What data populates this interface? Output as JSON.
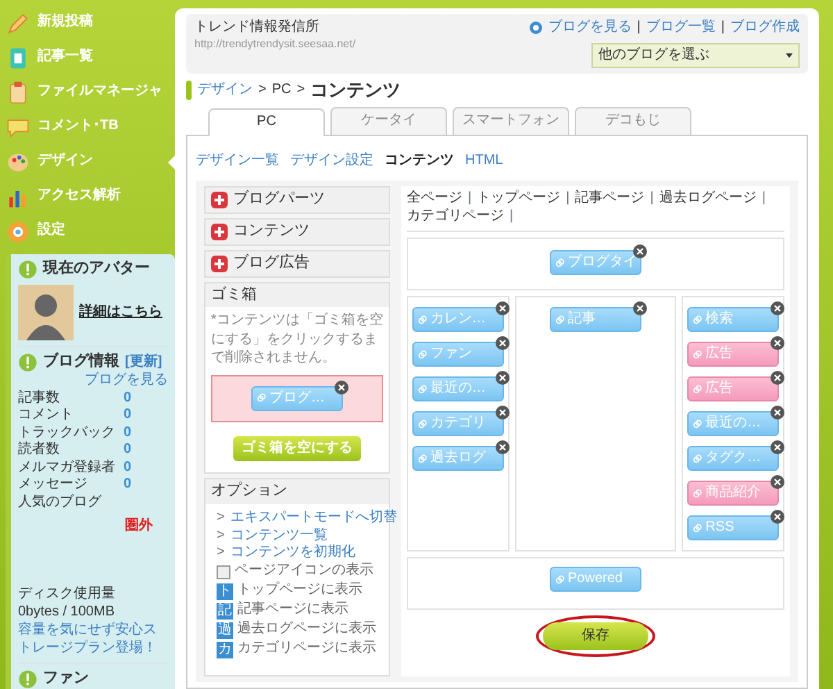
{
  "sidebar": {
    "menu": [
      {
        "label": "新規投稿",
        "selected": false
      },
      {
        "label": "記事一覧",
        "selected": false
      },
      {
        "label": "ファイルマネージャ",
        "selected": false
      },
      {
        "label": "コメント･TB",
        "selected": false
      },
      {
        "label": "デザイン",
        "selected": true
      },
      {
        "label": "アクセス解析",
        "selected": false
      },
      {
        "label": "設定",
        "selected": false
      }
    ],
    "avatar": {
      "title": "現在のアバター",
      "link": "詳細はこちら"
    },
    "blog_info": {
      "title": "ブログ情報",
      "refresh": "[更新]",
      "view_link": "ブログを見る",
      "stats": [
        {
          "label": "記事数",
          "value": "0",
          "alert": false
        },
        {
          "label": "コメント",
          "value": "0",
          "alert": false
        },
        {
          "label": "トラックバック",
          "value": "0",
          "alert": false
        },
        {
          "label": "読者数",
          "value": "0",
          "alert": false
        },
        {
          "label": "メルマガ登録者",
          "value": "0",
          "alert": false
        },
        {
          "label": "メッセージ",
          "value": "0",
          "alert": false
        },
        {
          "label": "人気のブログ",
          "value": "圏外",
          "alert": true
        }
      ]
    },
    "disk": {
      "label": "ディスク使用量",
      "usage": "0bytes / 100MB",
      "promo": "容量を気にせず安心ストレージプラン登場！"
    },
    "fan": {
      "title": "ファン"
    }
  },
  "header": {
    "site_title": "トレンド情報発信所",
    "url": "http://trendytrendysit.seesaa.net/",
    "separator": "|",
    "links": [
      "ブログを見る",
      "ブログ一覧",
      "ブログ作成"
    ],
    "blog_select": "他のブログを選ぶ"
  },
  "breadcrumb": {
    "separator": ">",
    "items": [
      "デザイン",
      "PC",
      "コンテンツ"
    ]
  },
  "tabs": [
    {
      "label": "PC",
      "selected": true
    },
    {
      "label": "ケータイ",
      "selected": false
    },
    {
      "label": "スマートフォン",
      "selected": false
    },
    {
      "label": "デコもじ",
      "selected": false
    }
  ],
  "subnav": [
    {
      "label": "デザイン一覧",
      "selected": false
    },
    {
      "label": "デザイン設定",
      "selected": false
    },
    {
      "label": "コンテンツ",
      "selected": true
    },
    {
      "label": "HTML",
      "selected": false
    }
  ],
  "parts_menu": [
    {
      "label": "ブログパーツ"
    },
    {
      "label": "コンテンツ"
    },
    {
      "label": "ブログ広告"
    }
  ],
  "trash": {
    "title": "ゴミ箱",
    "note": "*コンテンツは「ゴミ箱を空にする」をクリックするまで削除されません。",
    "blocks": [
      {
        "label": "ブログ…",
        "kind": "part"
      }
    ],
    "empty_button": "ゴミ箱を空にする"
  },
  "options": {
    "title": "オプション",
    "bullet": ">",
    "links": [
      "エキスパートモードへ切替",
      "コンテンツ一覧",
      "コンテンツを初期化"
    ],
    "page_icon_toggle": {
      "label": "ページアイコンの表示",
      "checked": false
    },
    "pages": [
      {
        "badge": "ト",
        "label": "トップページに表示"
      },
      {
        "badge": "記",
        "label": "記事ページに表示"
      },
      {
        "badge": "過",
        "label": "過去ログページに表示"
      },
      {
        "badge": "カ",
        "label": "カテゴリページに表示"
      }
    ]
  },
  "layout": {
    "separator": "|",
    "filters": [
      "全ページ",
      "トップページ",
      "記事ページ",
      "過去ログページ",
      "カテゴリページ"
    ],
    "header": [
      {
        "label": "ブログタイ",
        "kind": "part"
      }
    ],
    "columns": [
      [
        {
          "label": "カレン…",
          "kind": "part"
        },
        {
          "label": "ファン",
          "kind": "part"
        },
        {
          "label": "最近の…",
          "kind": "part"
        },
        {
          "label": "カテゴリ",
          "kind": "part"
        },
        {
          "label": "過去ログ",
          "kind": "part"
        }
      ],
      [
        {
          "label": "記事",
          "kind": "part"
        }
      ],
      [
        {
          "label": "検索",
          "kind": "part"
        },
        {
          "label": "広告",
          "kind": "ad"
        },
        {
          "label": "広告",
          "kind": "ad"
        },
        {
          "label": "最近の…",
          "kind": "part"
        },
        {
          "label": "タグク…",
          "kind": "part"
        },
        {
          "label": "商品紹介",
          "kind": "ad"
        },
        {
          "label": "RSS",
          "kind": "part"
        }
      ]
    ],
    "footer": [
      {
        "label": "Powered",
        "kind": "fixed"
      }
    ]
  },
  "save_button": {
    "label": "保存",
    "highlighted": true
  }
}
